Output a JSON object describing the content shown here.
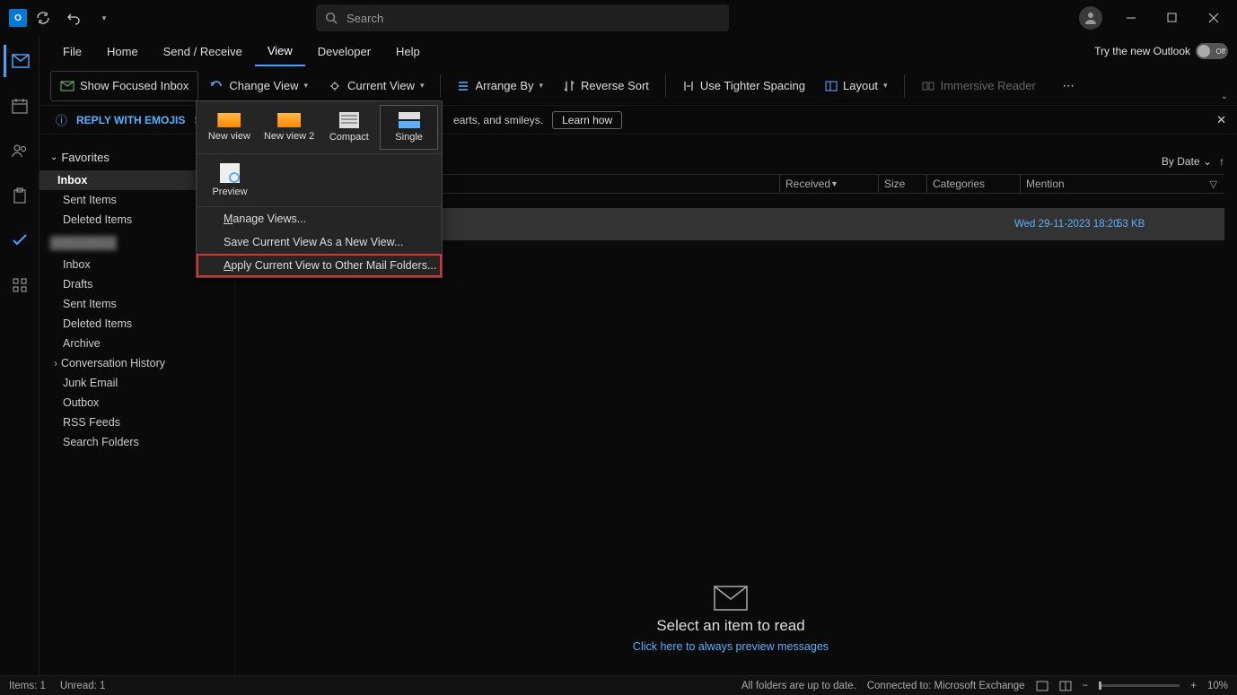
{
  "titlebar": {
    "search_placeholder": "Search"
  },
  "ribbon_tabs": [
    "File",
    "Home",
    "Send / Receive",
    "View",
    "Developer",
    "Help"
  ],
  "active_tab": "View",
  "try_outlook": {
    "label": "Try the new Outlook",
    "toggle": "Off"
  },
  "ribbon": {
    "focused": "Show Focused Inbox",
    "change_view": "Change View",
    "current_view": "Current View",
    "arrange_by": "Arrange By",
    "reverse_sort": "Reverse Sort",
    "tighter": "Use Tighter Spacing",
    "layout": "Layout",
    "immersive": "Immersive Reader"
  },
  "infobar": {
    "title": "REPLY WITH EMOJIS",
    "text_prefix": "Say w",
    "text_suffix": "earts, and smileys.",
    "learn": "Learn how"
  },
  "dropdown": {
    "items1": [
      "New view",
      "New view 2",
      "Compact",
      "Single"
    ],
    "preview": "Preview",
    "menu": [
      "Manage Views...",
      "Save Current View As a New View...",
      "Apply Current View to Other Mail Folders..."
    ]
  },
  "folders": {
    "favorites": "Favorites",
    "fav_items": [
      "Inbox",
      "Sent Items",
      "Deleted Items"
    ],
    "account_items": [
      "Inbox",
      "Drafts",
      "Sent Items",
      "Deleted Items",
      "Archive",
      "Conversation History",
      "Junk Email",
      "Outbox",
      "RSS Feeds",
      "Search Folders"
    ]
  },
  "list": {
    "sort": "By Date",
    "cols": {
      "received": "Received",
      "size": "Size",
      "categories": "Categories",
      "mention": "Mention"
    },
    "row": {
      "date": "Wed 29-11-2023 18:20",
      "size": "53 KB"
    }
  },
  "reading": {
    "title": "Select an item to read",
    "link": "Click here to always preview messages"
  },
  "status": {
    "items": "Items: 1",
    "unread": "Unread: 1",
    "uptodate": "All folders are up to date.",
    "connected": "Connected to: Microsoft Exchange",
    "zoom": "10%"
  }
}
